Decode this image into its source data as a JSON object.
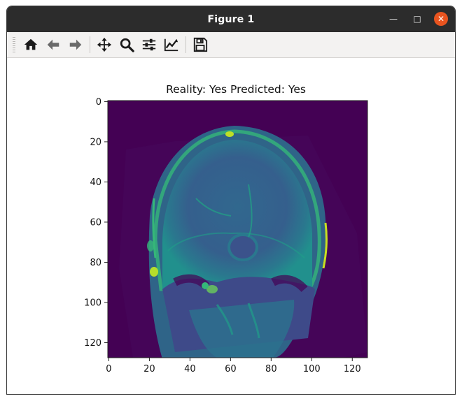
{
  "window": {
    "title": "Figure 1"
  },
  "toolbar": {
    "items": [
      {
        "icon": "home-icon",
        "name": "home-button"
      },
      {
        "icon": "back-arrow-icon",
        "name": "back-button"
      },
      {
        "icon": "forward-arrow-icon",
        "name": "forward-button"
      },
      {
        "icon": "pan-icon",
        "name": "pan-button"
      },
      {
        "icon": "zoom-icon",
        "name": "zoom-button"
      },
      {
        "icon": "configure-subplots-icon",
        "name": "configure-subplots-button"
      },
      {
        "icon": "edit-axes-icon",
        "name": "edit-axes-button"
      },
      {
        "icon": "save-icon",
        "name": "save-button"
      }
    ]
  },
  "plot": {
    "title": "Reality: Yes Predicted: Yes",
    "colormap": "viridis",
    "x_ticks": [
      0,
      20,
      40,
      60,
      80,
      100,
      120
    ],
    "y_ticks": [
      0,
      20,
      40,
      60,
      80,
      100,
      120
    ],
    "x_range": [
      -0.5,
      127.5
    ],
    "y_range": [
      -0.5,
      127.5
    ]
  },
  "colors": {
    "background_low": "#440154",
    "mid": "#2a788e",
    "high": "#22a884",
    "peak": "#bddf26"
  }
}
